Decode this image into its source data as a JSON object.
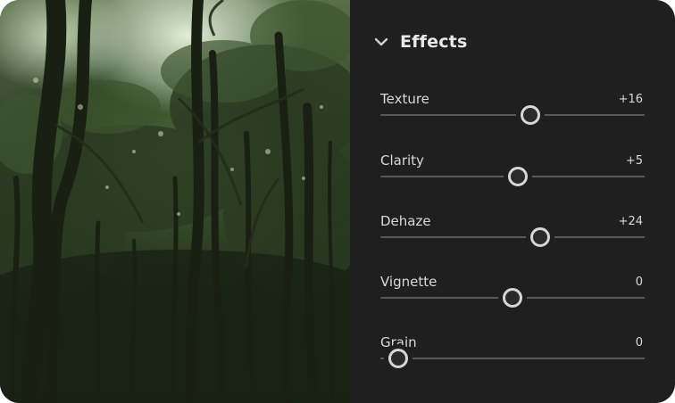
{
  "photo": {
    "description_name": "forest-photo"
  },
  "effects_panel": {
    "title": "Effects",
    "expanded": true,
    "toggle_icon": "chevron-down-icon",
    "sliders": [
      {
        "id": "texture",
        "label": "Texture",
        "value_text": "+16",
        "value": 16,
        "min": -100,
        "max": 100
      },
      {
        "id": "clarity",
        "label": "Clarity",
        "value_text": "+5",
        "value": 5,
        "min": -100,
        "max": 100
      },
      {
        "id": "dehaze",
        "label": "Dehaze",
        "value_text": "+24",
        "value": 24,
        "min": -100,
        "max": 100
      },
      {
        "id": "vignette",
        "label": "Vignette",
        "value_text": "0",
        "value": 0,
        "min": -100,
        "max": 100
      },
      {
        "id": "grain",
        "label": "Grain",
        "value_text": "0",
        "value": 0,
        "min": 0,
        "max": 100
      }
    ]
  },
  "colors": {
    "panel_bg": "#1f1f1f",
    "text": "#d9d9d9",
    "track": "#5a5a5a",
    "thumb_ring": "#d6d6d6"
  }
}
